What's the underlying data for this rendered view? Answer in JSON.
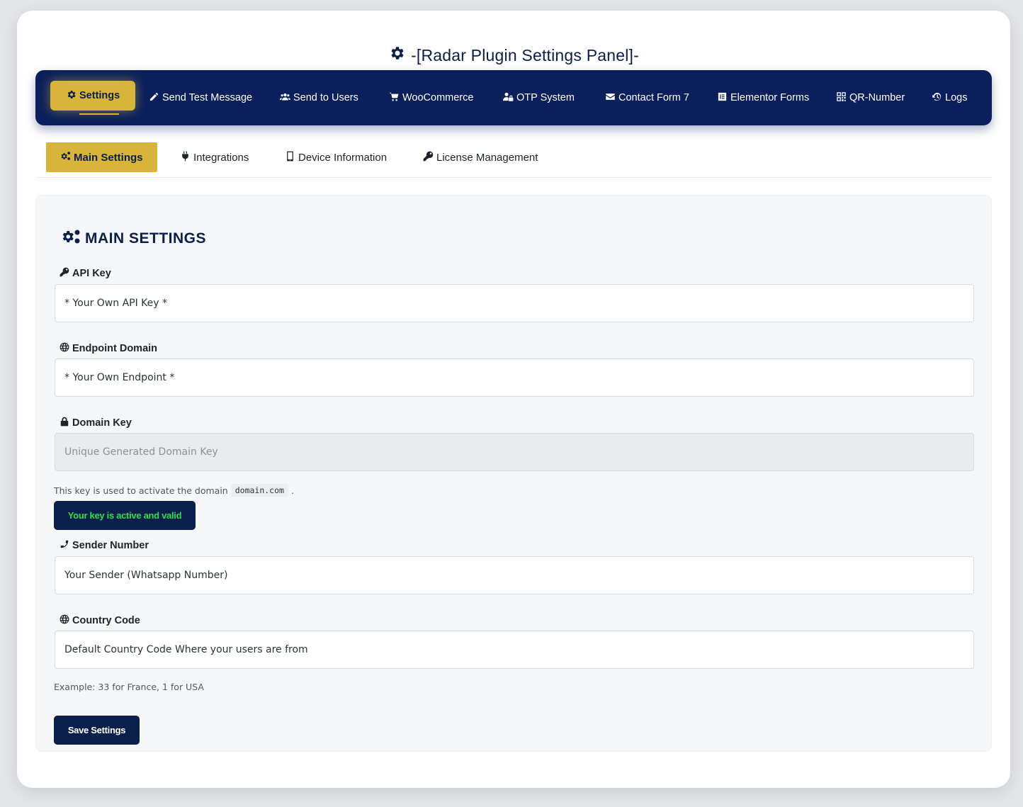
{
  "page": {
    "title": "-[Radar Plugin Settings Panel]-",
    "title_icon": "gear-icon"
  },
  "topnav": {
    "items": [
      {
        "label": "Settings",
        "icon": "gear-icon",
        "active": true
      },
      {
        "label": "Send Test Message",
        "icon": "pencil-icon"
      },
      {
        "label": "Send to Users",
        "icon": "users-icon"
      },
      {
        "label": "WooCommerce",
        "icon": "cart-icon"
      },
      {
        "label": "OTP System",
        "icon": "user-lock-icon"
      },
      {
        "label": "Contact Form 7",
        "icon": "envelope-icon"
      },
      {
        "label": "Elementor Forms",
        "icon": "elementor-icon"
      },
      {
        "label": "QR-Number",
        "icon": "qrcode-icon"
      },
      {
        "label": "Logs",
        "icon": "history-icon"
      }
    ]
  },
  "subtabs": {
    "items": [
      {
        "label": "Main Settings",
        "icon": "gears-icon",
        "active": true
      },
      {
        "label": "Integrations",
        "icon": "plug-icon"
      },
      {
        "label": "Device Information",
        "icon": "mobile-icon"
      },
      {
        "label": "License Management",
        "icon": "key-icon"
      }
    ]
  },
  "main": {
    "section_title": "MAIN SETTINGS",
    "fields": {
      "api_key": {
        "label": "API Key",
        "icon": "key-icon",
        "value": "* Your Own API Key *"
      },
      "endpoint": {
        "label": "Endpoint Domain",
        "icon": "globe-icon",
        "value": "* Your Own Endpoint *"
      },
      "domain_key": {
        "label": "Domain Key",
        "icon": "lock-icon",
        "placeholder": "Unique Generated Domain Key",
        "disabled": true
      },
      "sender": {
        "label": "Sender Number",
        "icon": "phone-icon",
        "value": "Your Sender (Whatsapp Number)"
      },
      "country": {
        "label": "Country Code",
        "icon": "globe-icon",
        "value": "Default Country Code Where your users are from"
      }
    },
    "domain_help": {
      "text": "This key is used to activate the domain",
      "code": "domain.com",
      "suffix": "."
    },
    "status": "Your key is active and valid",
    "country_help": "Example: 33 for France, 1 for USA",
    "save_label": "Save Settings"
  },
  "colors": {
    "navy": "#0a1f5c",
    "gold": "#d9b43a",
    "status_green": "#29e04a"
  }
}
